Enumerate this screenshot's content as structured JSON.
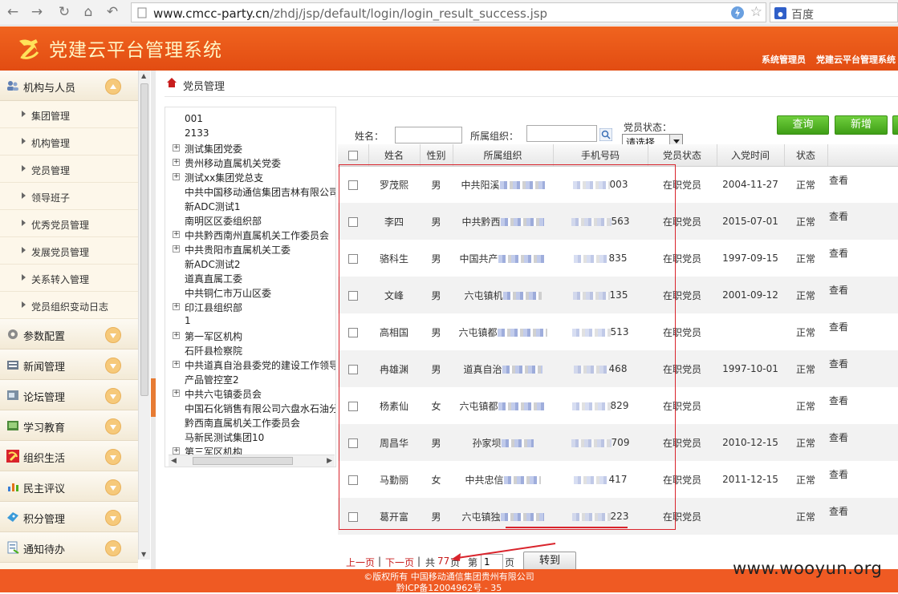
{
  "browser": {
    "url_host": "www.cmcc-party.cn",
    "url_path": "/zhdj/jsp/default/login/login_result_success.jsp",
    "search_engine": "百度"
  },
  "header": {
    "title": "党建云平台管理系统",
    "user": "系统管理员",
    "system": "党建云平台管理系统"
  },
  "sidebar": {
    "groups": [
      {
        "label": "机构与人员",
        "icon": "people-icon",
        "expanded": true,
        "items": [
          "集团管理",
          "机构管理",
          "党员管理",
          "领导班子",
          "优秀党员管理",
          "发展党员管理",
          "关系转入管理",
          "党员组织变动日志"
        ]
      },
      {
        "label": "参数配置",
        "icon": "gear-icon"
      },
      {
        "label": "新闻管理",
        "icon": "news-icon"
      },
      {
        "label": "论坛管理",
        "icon": "forum-icon"
      },
      {
        "label": "学习教育",
        "icon": "education-icon"
      },
      {
        "label": "组织生活",
        "icon": "party-emblem-icon"
      },
      {
        "label": "民主评议",
        "icon": "chart-icon"
      },
      {
        "label": "积分管理",
        "icon": "points-icon"
      },
      {
        "label": "通知待办",
        "icon": "notice-icon"
      }
    ]
  },
  "breadcrumb": "党员管理",
  "tree": [
    {
      "label": "001",
      "toggle": false
    },
    {
      "label": "2133",
      "toggle": false
    },
    {
      "label": "测试集团党委",
      "toggle": true
    },
    {
      "label": "贵州移动直属机关党委",
      "toggle": true
    },
    {
      "label": "测试xx集团党总支",
      "toggle": true
    },
    {
      "label": "中共中国移动通信集团吉林有限公司",
      "toggle": false
    },
    {
      "label": "新ADC测试1",
      "toggle": false
    },
    {
      "label": "南明区区委组织部",
      "toggle": false
    },
    {
      "label": "中共黔西南州直属机关工作委员会",
      "toggle": true
    },
    {
      "label": "中共贵阳市直属机关工委",
      "toggle": true
    },
    {
      "label": "新ADC测试2",
      "toggle": false
    },
    {
      "label": "道真直属工委",
      "toggle": false
    },
    {
      "label": "中共铜仁市万山区委",
      "toggle": false
    },
    {
      "label": "印江县组织部",
      "toggle": true
    },
    {
      "label": "1",
      "toggle": false
    },
    {
      "label": "第一军区机构",
      "toggle": true
    },
    {
      "label": "石阡县检察院",
      "toggle": false
    },
    {
      "label": "中共道真自治县委党的建设工作领导",
      "toggle": true
    },
    {
      "label": "产品管控室2",
      "toggle": false
    },
    {
      "label": "中共六屯镇委员会",
      "toggle": true
    },
    {
      "label": "中国石化销售有限公司六盘水石油分",
      "toggle": false
    },
    {
      "label": "黔西南直属机关工作委员会",
      "toggle": false
    },
    {
      "label": "马新民测试集团10",
      "toggle": false
    },
    {
      "label": "第三军区机构",
      "toggle": true
    }
  ],
  "filters": {
    "name_label": "姓名：",
    "org_label": "所属组织：",
    "status_label": "党员状态：",
    "status_value": "请选择",
    "name_value": "",
    "org_value": ""
  },
  "buttons": {
    "query": "查询",
    "add": "新增"
  },
  "table": {
    "columns": [
      "姓名",
      "性别",
      "所属组织",
      "手机号码",
      "党员状态",
      "入党时间",
      "状态"
    ],
    "rows": [
      {
        "name": "罗茂熙",
        "gender": "男",
        "org": "中共阳溪",
        "phone": "003",
        "status": "在职党员",
        "join_date": "2004-11-27",
        "state": "正常"
      },
      {
        "name": "李四",
        "gender": "男",
        "org": "中共黔西",
        "phone": "563",
        "status": "在职党员",
        "join_date": "2015-07-01",
        "state": "正常"
      },
      {
        "name": "骆科生",
        "gender": "男",
        "org": "中国共产",
        "phone": "835",
        "status": "在职党员",
        "join_date": "1997-09-15",
        "state": "正常"
      },
      {
        "name": "文峰",
        "gender": "男",
        "org": "六屯镇机",
        "phone": "135",
        "status": "在职党员",
        "join_date": "2001-09-12",
        "state": "正常"
      },
      {
        "name": "高相国",
        "gender": "男",
        "org": "六屯镇都",
        "phone": "513",
        "status": "在职党员",
        "join_date": "",
        "state": "正常"
      },
      {
        "name": "冉雄渊",
        "gender": "男",
        "org": "道真自治",
        "phone": "468",
        "status": "在职党员",
        "join_date": "1997-10-01",
        "state": "正常"
      },
      {
        "name": "杨素仙",
        "gender": "女",
        "org": "六屯镇都",
        "phone": "829",
        "status": "在职党员",
        "join_date": "",
        "state": "正常"
      },
      {
        "name": "周昌华",
        "gender": "男",
        "org": "孙家坝",
        "phone": "709",
        "status": "在职党员",
        "join_date": "2010-12-15",
        "state": "正常"
      },
      {
        "name": "马勤丽",
        "gender": "女",
        "org": "中共忠信",
        "phone": "417",
        "status": "在职党员",
        "join_date": "2011-12-15",
        "state": "正常"
      },
      {
        "name": "葛开富",
        "gender": "男",
        "org": "六屯镇独",
        "phone": "223",
        "status": "在职党员",
        "join_date": "",
        "state": "正常"
      }
    ],
    "view_label": "查看"
  },
  "pagination": {
    "prev": "上一页",
    "next": "下一页",
    "sep": "|",
    "total_prefix": "共",
    "total_pages": "77",
    "page_unit": "页",
    "goto_prefix": "第",
    "current_page": "1",
    "goto_label": "转到"
  },
  "footer": {
    "line1": "©版权所有 中国移动通信集团贵州有限公司",
    "line2": "黔ICP备12004962号 - 35"
  },
  "watermark": "www.wooyun.org",
  "colors": {
    "header_orange": "#e24c12",
    "button_green": "#4caf1e",
    "highlight_red": "#d9242c",
    "link_orange": "#e27a14"
  }
}
